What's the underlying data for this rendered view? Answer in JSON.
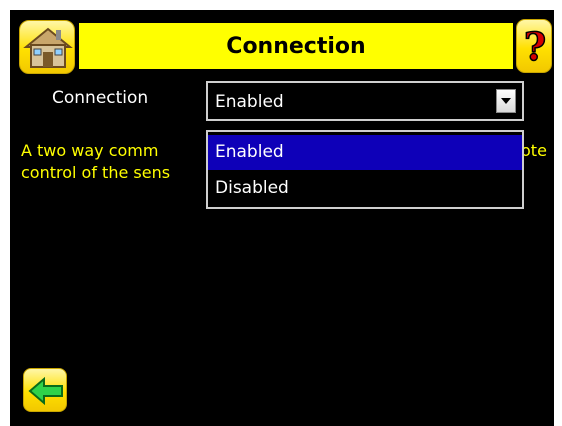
{
  "header": {
    "title": "Connection",
    "home_icon": "home-icon",
    "help_icon": "help-icon"
  },
  "setting": {
    "label": "Connection",
    "value": "Enabled",
    "options": [
      "Enabled",
      "Disabled"
    ],
    "selected_option": "Enabled"
  },
  "description": {
    "line1_visible_left": "A two way comm",
    "line1_visible_right": "ote",
    "line2_visible_left": "control of the sens"
  },
  "footer": {
    "back_icon": "back-arrow-icon"
  },
  "colors": {
    "background": "#000000",
    "title_bar": "#ffff00",
    "description_text": "#ffff00",
    "selected_option": "#0e00b8"
  }
}
